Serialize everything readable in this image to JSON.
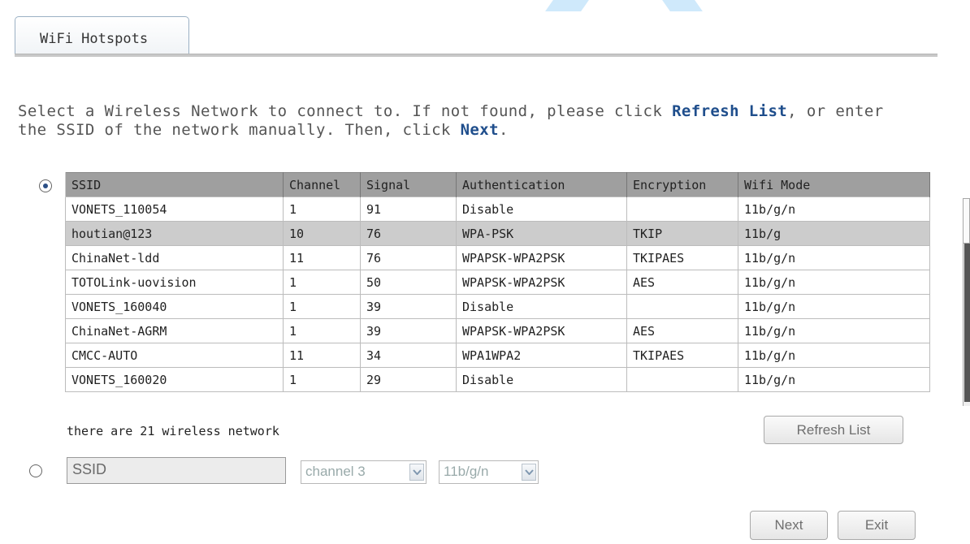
{
  "tabs": [
    {
      "label": "WiFi Hotspots"
    }
  ],
  "instruction": {
    "part1": "Select a Wireless Network to connect to. If not found, please click ",
    "refresh_link": "Refresh List",
    "part2": ", or enter the SSID of the network manually. Then, click ",
    "next_link": "Next",
    "part3": "."
  },
  "table": {
    "headers": [
      "SSID",
      "Channel",
      "Signal",
      "Authentication",
      "Encryption",
      "Wifi Mode"
    ],
    "rows": [
      [
        "VONETS_110054",
        "1",
        "91",
        "Disable",
        "",
        "11b/g/n"
      ],
      [
        "houtian@123",
        "10",
        "76",
        "WPA-PSK",
        "TKIP",
        "11b/g"
      ],
      [
        "ChinaNet-ldd",
        "11",
        "76",
        "WPAPSK-WPA2PSK",
        "TKIPAES",
        "11b/g/n"
      ],
      [
        "TOTOLink-uovision",
        "1",
        "50",
        "WPAPSK-WPA2PSK",
        "AES",
        "11b/g/n"
      ],
      [
        "VONETS_160040",
        "1",
        "39",
        "Disable",
        "",
        "11b/g/n"
      ],
      [
        "ChinaNet-AGRM",
        "1",
        "39",
        "WPAPSK-WPA2PSK",
        "AES",
        "11b/g/n"
      ],
      [
        "CMCC-AUTO",
        "11",
        "34",
        "WPA1WPA2",
        "TKIPAES",
        "11b/g/n"
      ],
      [
        "VONETS_160020",
        "1",
        "29",
        "Disable",
        "",
        "11b/g/n"
      ]
    ],
    "selected_row": 1
  },
  "network_count": "there are 21 wireless network",
  "buttons": {
    "refresh": "Refresh List",
    "next": "Next",
    "exit": "Exit"
  },
  "manual": {
    "ssid_value": "SSID",
    "channel_value": "channel 3",
    "mode_value": "11b/g/n"
  },
  "radio": {
    "list_selected": true,
    "manual_selected": false
  },
  "colors": {
    "accent": "#1f4e8c",
    "header_bg": "#9f9f9f",
    "selected_row": "#cccccc"
  }
}
